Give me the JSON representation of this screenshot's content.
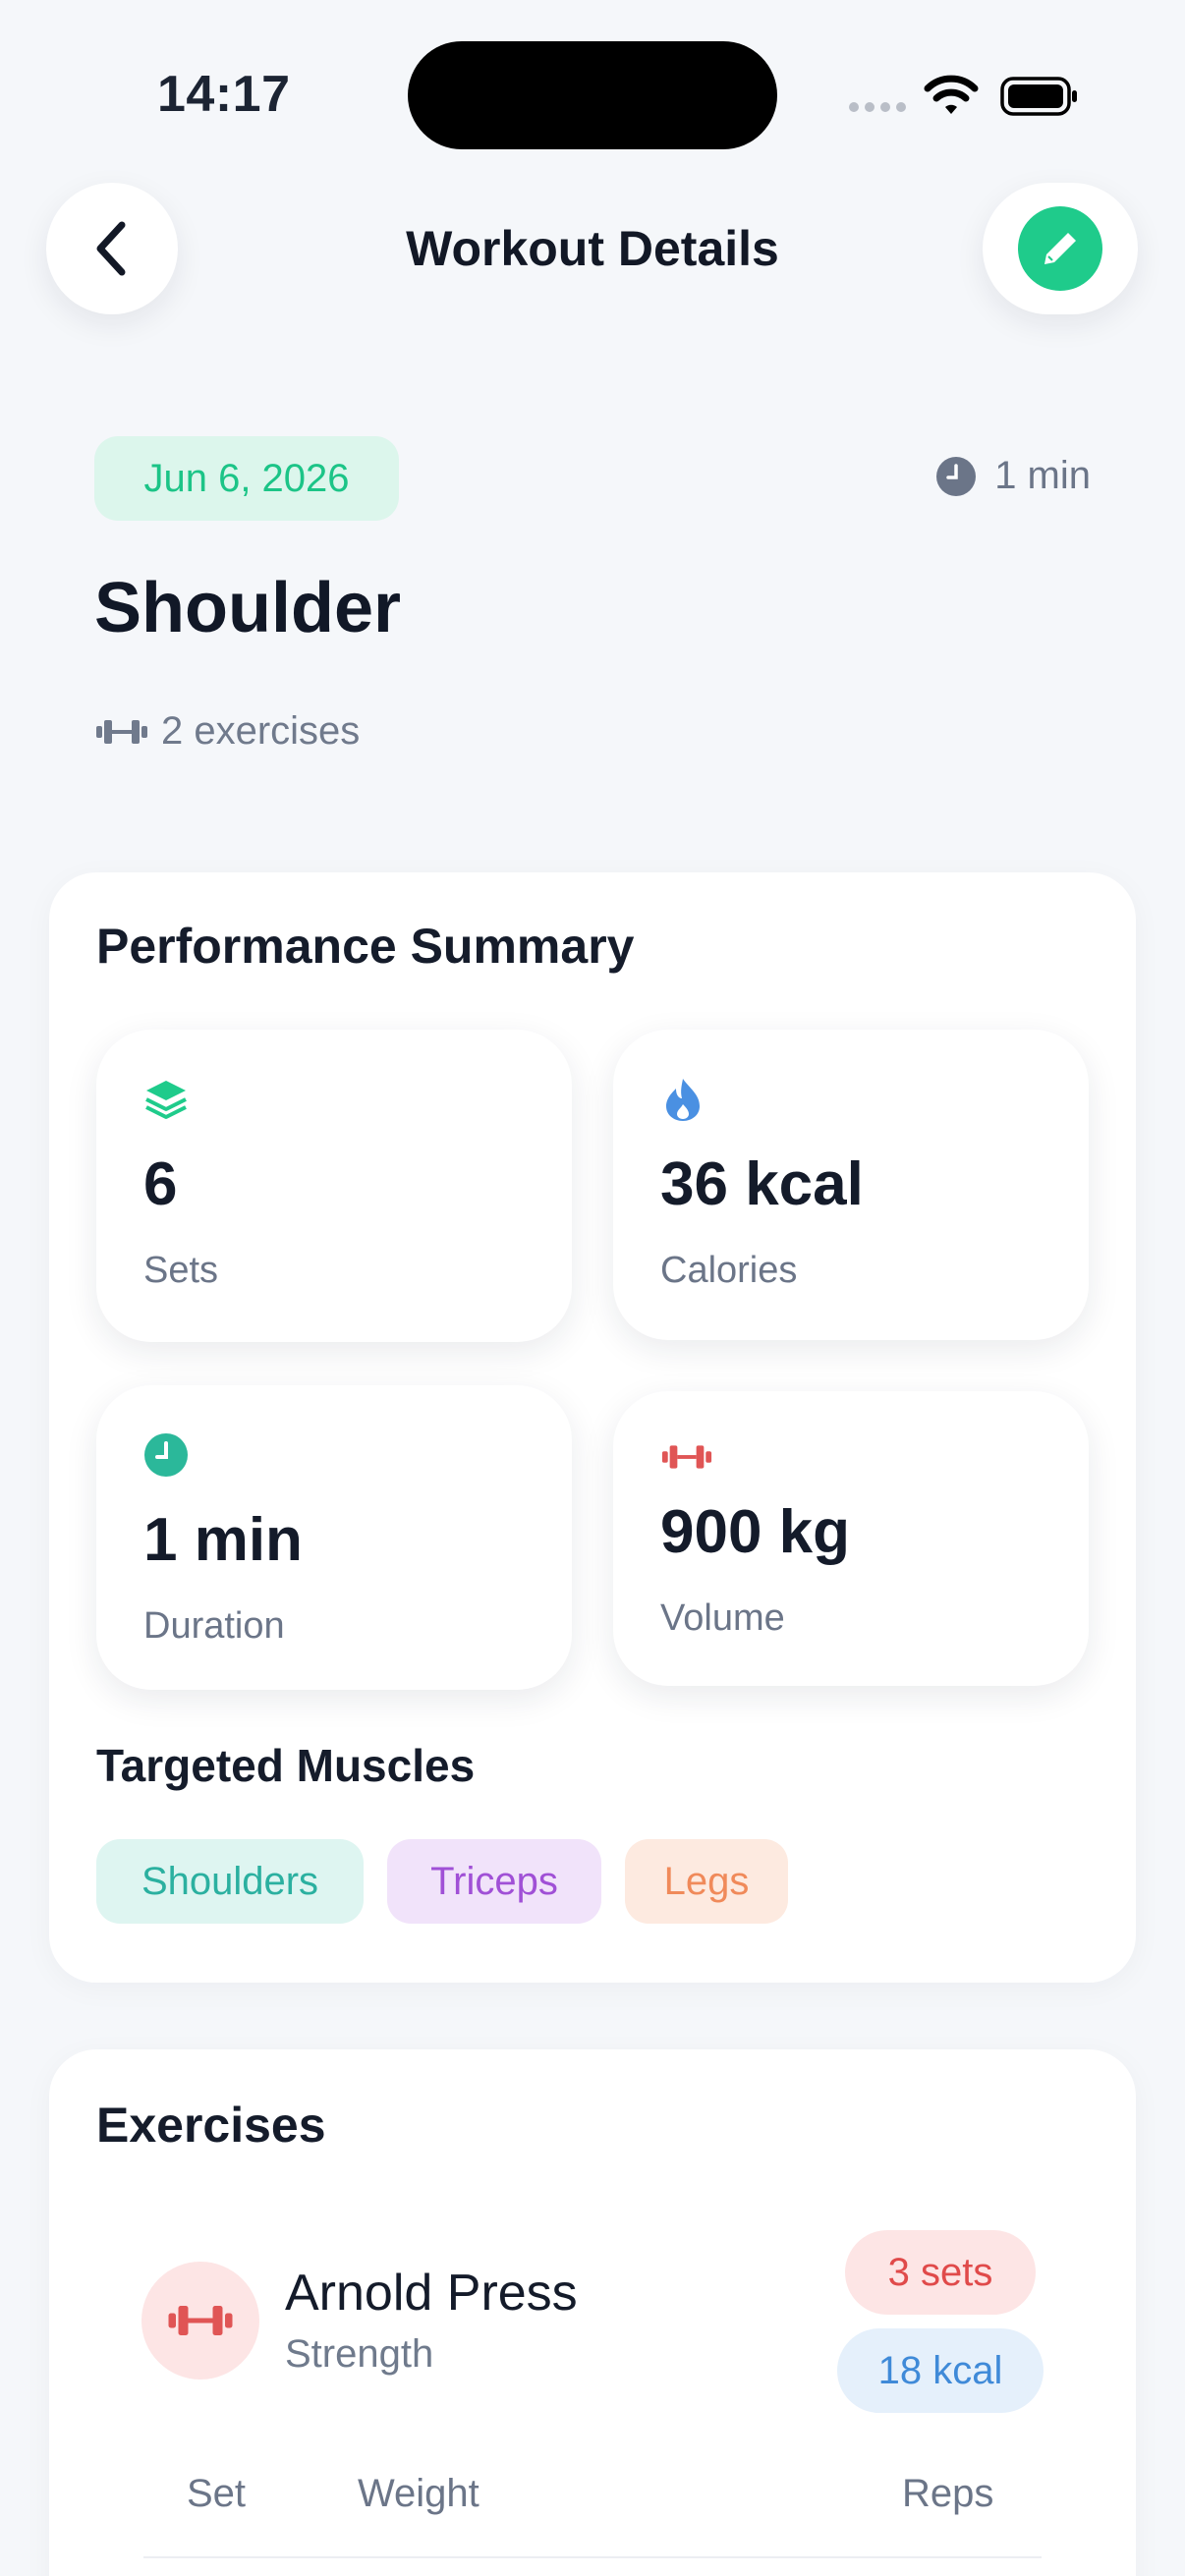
{
  "status_bar": {
    "time": "14:17"
  },
  "nav": {
    "title": "Workout Details"
  },
  "workout": {
    "date": "Jun 6, 2026",
    "duration": "1 min",
    "name": "Shoulder",
    "exercise_count": "2 exercises"
  },
  "summary": {
    "title": "Performance Summary",
    "stats": [
      {
        "value": "6",
        "label": "Sets",
        "icon": "layers-icon",
        "color": "#1fcb8b"
      },
      {
        "value": "36 kcal",
        "label": "Calories",
        "icon": "flame-icon",
        "color": "#4a90e2"
      },
      {
        "value": "1 min",
        "label": "Duration",
        "icon": "clock-icon",
        "color": "#2bb89a"
      },
      {
        "value": "900 kg",
        "label": "Volume",
        "icon": "dumbbell-icon",
        "color": "#e05555"
      }
    ],
    "muscles_title": "Targeted Muscles",
    "muscles": [
      {
        "label": "Shoulders",
        "bg": "#def5f1",
        "fg": "#2bb0a0"
      },
      {
        "label": "Triceps",
        "bg": "#f1e3fa",
        "fg": "#a050d6"
      },
      {
        "label": "Legs",
        "bg": "#fdeae0",
        "fg": "#f08a5a"
      }
    ]
  },
  "exercises": {
    "title": "Exercises",
    "items": [
      {
        "name": "Arnold Press",
        "type": "Strength",
        "sets_badge": "3 sets",
        "kcal_badge": "18 kcal",
        "columns": [
          "Set",
          "Weight",
          "Reps"
        ]
      }
    ]
  },
  "colors": {
    "accent": "#1fcb8b",
    "background": "#f5f7fa"
  }
}
